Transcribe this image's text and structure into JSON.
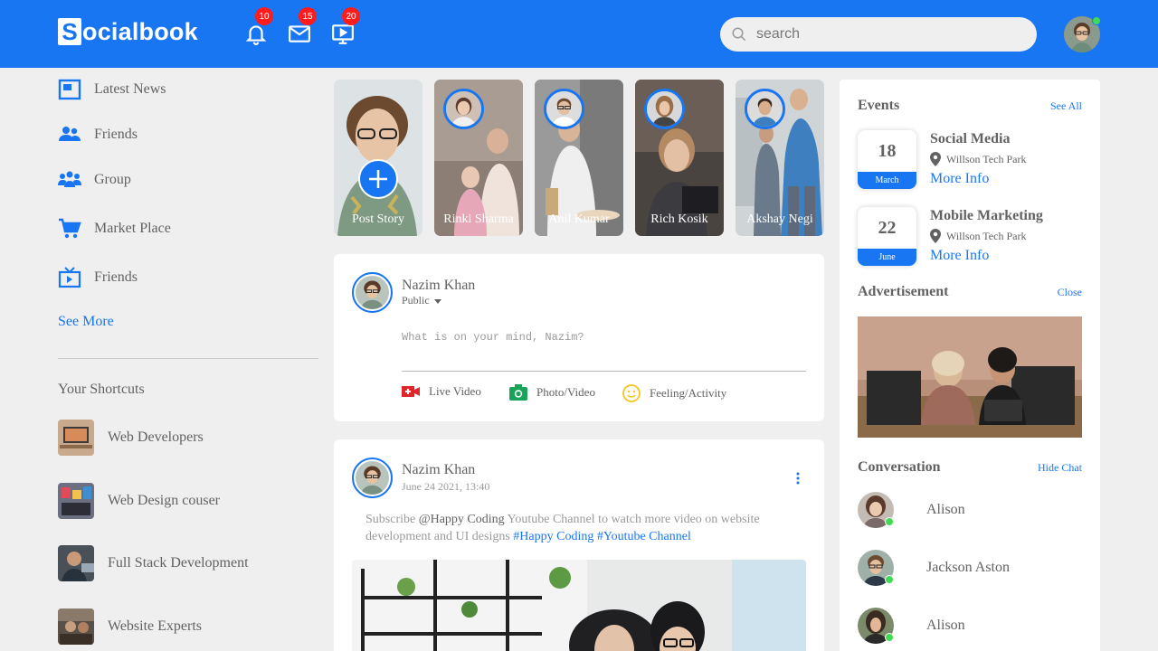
{
  "brand": {
    "logo_letter": "S",
    "logo_rest": "ocialbook",
    "color": "#1876f2"
  },
  "nav": {
    "notifications_count": "10",
    "messages_count": "15",
    "videos_count": "20",
    "search_placeholder": "search"
  },
  "sidebar": {
    "items": [
      {
        "label": "Latest News",
        "icon": "news-icon"
      },
      {
        "label": "Friends",
        "icon": "friends-icon"
      },
      {
        "label": "Group",
        "icon": "group-icon"
      },
      {
        "label": "Market Place",
        "icon": "cart-icon"
      },
      {
        "label": "Friends",
        "icon": "tv-icon"
      }
    ],
    "see_more": "See More",
    "shortcuts_title": "Your Shortcuts",
    "shortcuts": [
      {
        "label": "Web Developers"
      },
      {
        "label": "Web Design couser"
      },
      {
        "label": "Full Stack Development"
      },
      {
        "label": "Website Experts"
      }
    ]
  },
  "stories": [
    {
      "label": "Post Story"
    },
    {
      "label": "Rinki Sharma"
    },
    {
      "label": "Anil Kumar"
    },
    {
      "label": "Rich Kosik"
    },
    {
      "label": "Akshay Negi"
    }
  ],
  "composer": {
    "user_name": "Nazim Khan",
    "privacy": "Public",
    "placeholder": "What is on your mind, Nazim?",
    "actions": [
      {
        "label": "Live Video",
        "icon": "live-video-icon"
      },
      {
        "label": "Photo/Video",
        "icon": "camera-icon"
      },
      {
        "label": "Feeling/Activity",
        "icon": "smiley-icon"
      }
    ]
  },
  "post": {
    "user_name": "Nazim Khan",
    "date": "June 24 2021, 13:40",
    "text_1": "Subscribe ",
    "mention": "@Happy Coding",
    "text_2": " Youtube Channel to watch more video on website development and UI designs ",
    "tag_1": "#Happy Coding",
    "tag_2": " #Youtube Channel"
  },
  "events": {
    "title": "Events",
    "see_all": "See All",
    "items": [
      {
        "day": "18",
        "month": "March",
        "title": "Social Media",
        "location": "Willson Tech Park",
        "more": "More Info"
      },
      {
        "day": "22",
        "month": "June",
        "title": "Mobile Marketing",
        "location": "Willson Tech Park",
        "more": "More Info"
      }
    ]
  },
  "advertisement": {
    "title": "Advertisement",
    "close": "Close"
  },
  "conversation": {
    "title": "Conversation",
    "hide": "Hide Chat",
    "people": [
      {
        "name": "Alison"
      },
      {
        "name": "Jackson Aston"
      },
      {
        "name": "Alison"
      }
    ]
  }
}
